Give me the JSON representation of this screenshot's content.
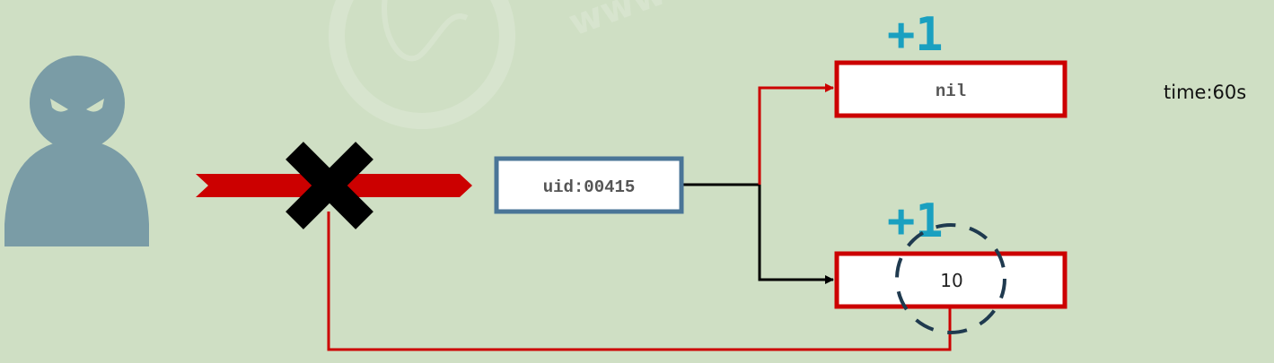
{
  "user_box": {
    "label": "uid:00415"
  },
  "top_box": {
    "label": "nil",
    "increment": "+1"
  },
  "bottom_box": {
    "label": "10",
    "increment": "+1"
  },
  "ttl_label": "time:60s",
  "watermark": "www",
  "colors": {
    "background": "#cfdfc4",
    "red": "#cc0000",
    "blue_box": "#4a7597",
    "accent": "#1aa0c0",
    "person": "#7a9ca6",
    "dark": "#1f3a4f"
  }
}
